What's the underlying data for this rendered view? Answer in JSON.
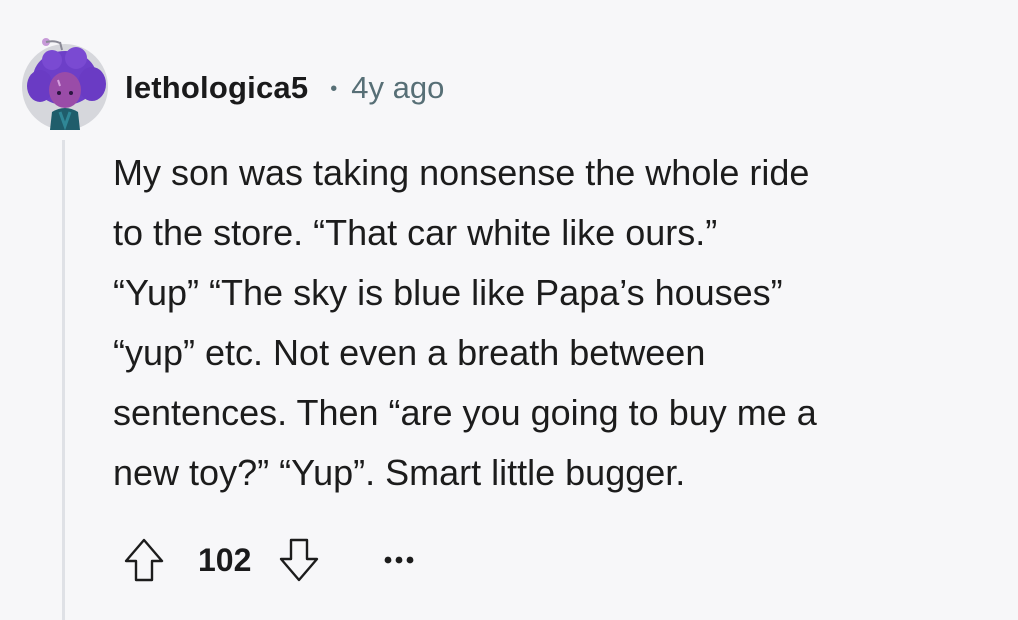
{
  "comment": {
    "author": "lethologica5",
    "separator": "•",
    "age": "4y ago",
    "avatar_icon": "snoo-avatar-icon",
    "body_lines": [
      "My son was taking nonsense the whole ride",
      "to the store. “That car white like ours.”",
      "“Yup” “The sky is blue like Papa’s houses”",
      "“yup” etc. Not even a breath between",
      "sentences. Then “are you going to buy me a",
      "new toy?” “Yup”. Smart little bugger."
    ],
    "score": "102",
    "icons": {
      "upvote": "upvote-arrow-icon",
      "downvote": "downvote-arrow-icon",
      "more": "more-options-icon"
    },
    "colors": {
      "background": "#f7f7f9",
      "text": "#1c1c1c",
      "meta": "#576f76",
      "avatar_hair": "#6d3fc8",
      "thread_line": "#dfe1e6"
    }
  }
}
